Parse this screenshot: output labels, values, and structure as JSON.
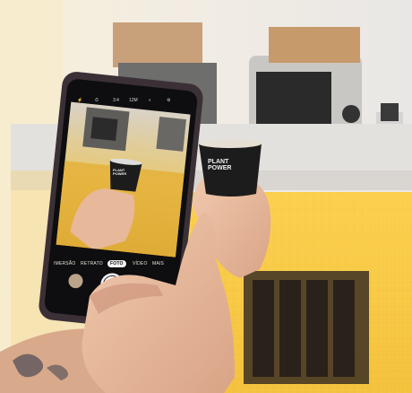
{
  "camera_ui": {
    "status_icons": [
      "flash-off-icon",
      "timer-icon",
      "3:4",
      "12M",
      "hdr-icon",
      "settings-icon"
    ],
    "status_ratio": "3:4",
    "status_resolution": "12M",
    "modes": [
      "IMERSÃO",
      "RETRATO",
      "FOTO",
      "VÍDEO",
      "MAIS"
    ],
    "active_mode": "FOTO"
  },
  "cup": {
    "brand_line1": "PLANT",
    "brand_line2": "POWER"
  },
  "colors": {
    "counter_glow": "#f5c23a",
    "phone_frame": "#3a3036",
    "cup": "#1c1c1c"
  }
}
